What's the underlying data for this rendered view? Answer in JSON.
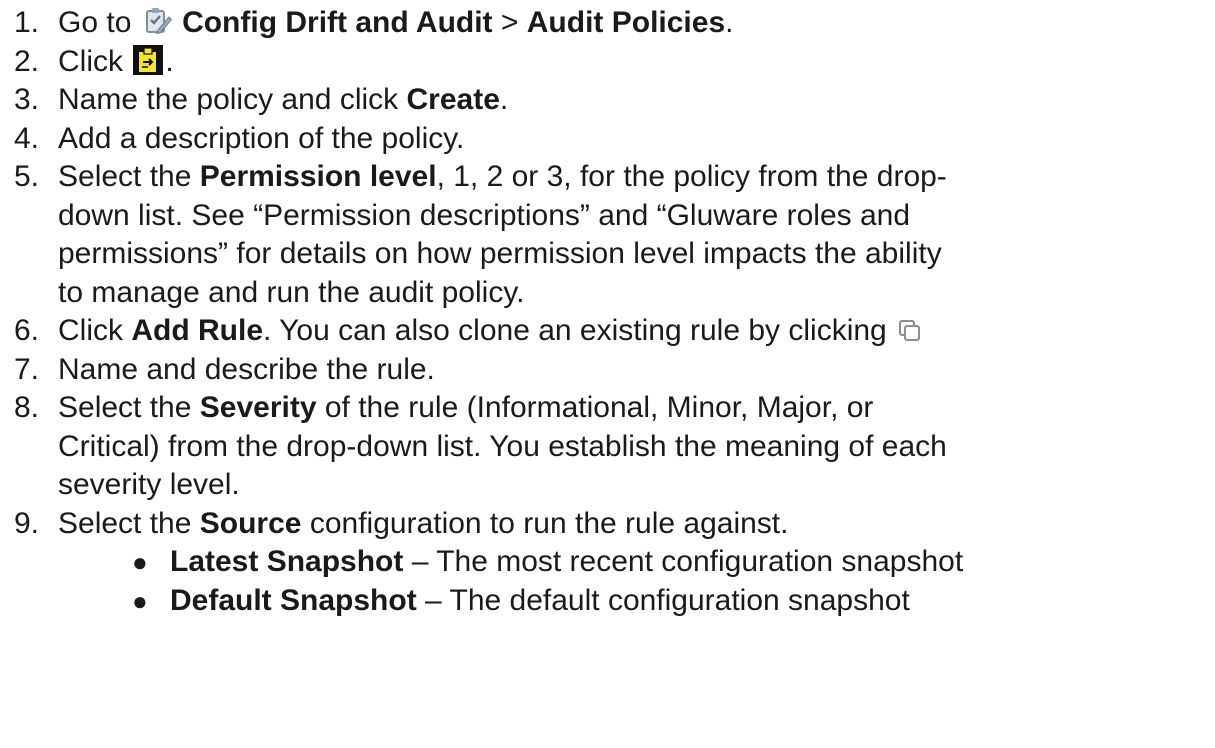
{
  "steps": [
    {
      "num": "1.",
      "pre": "Go to ",
      "icon1": "audit-clipboard-icon",
      "bold1": "Config Drift and Audit",
      "mid": " > ",
      "bold2": "Audit Policies",
      "post": "."
    },
    {
      "num": "2.",
      "pre": "Click ",
      "icon": "add-policy-icon",
      "post": "."
    },
    {
      "num": "3.",
      "pre": "Name the policy and click ",
      "bold": "Create",
      "post": "."
    },
    {
      "num": "4.",
      "text": "Add a description of the policy."
    },
    {
      "num": "5.",
      "pre": "Select the ",
      "bold": "Permission level",
      "post": ", 1, 2 or 3, for the policy from the drop-",
      "cont": [
        "down list. See “Permission descriptions” and “Gluware roles and",
        "permissions” for details on how permission level impacts the ability",
        "to manage and run the audit policy."
      ]
    },
    {
      "num": "6.",
      "pre": "Click ",
      "bold": "Add Rule",
      "post": ". You can also clone an existing rule by clicking ",
      "icon": "clone-icon"
    },
    {
      "num": "7.",
      "text": "Name and describe the rule."
    },
    {
      "num": "8.",
      "pre": "Select the ",
      "bold": "Severity",
      "post": " of the rule (Informational, Minor, Major, or",
      "cont": [
        "Critical) from the drop-down list. You establish the meaning of each",
        "severity level."
      ]
    },
    {
      "num": "9.",
      "pre": "Select the ",
      "bold": "Source",
      "post": " configuration to run the rule against.",
      "bullets": [
        {
          "bold": "Latest Snapshot",
          "text": " – The most recent configuration snapshot"
        },
        {
          "bold": "Default Snapshot",
          "text": " – The default configuration snapshot"
        }
      ]
    }
  ]
}
